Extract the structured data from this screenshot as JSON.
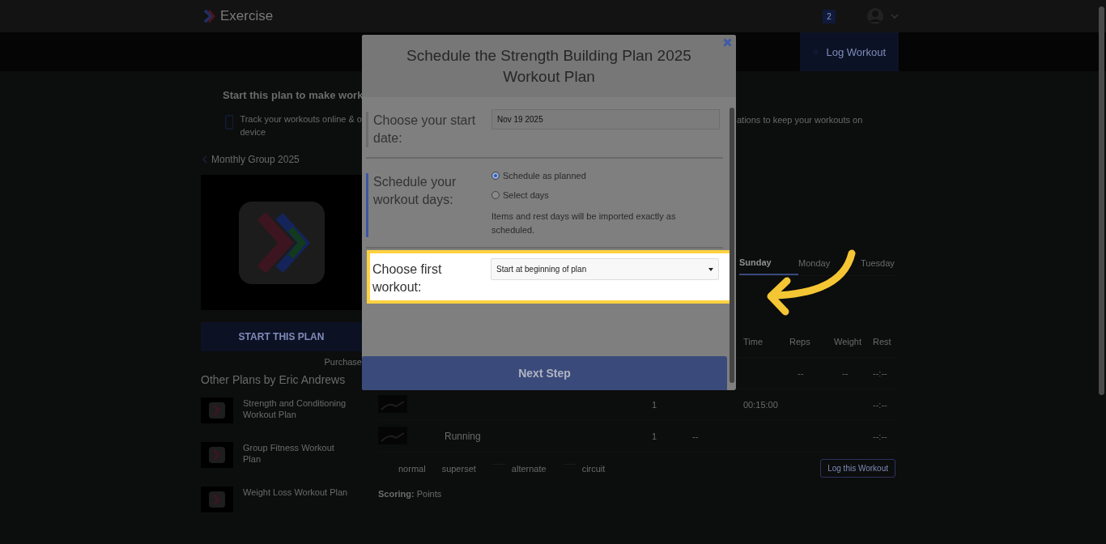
{
  "topbar": {
    "logo": "Exercise",
    "notification_count": "2"
  },
  "action_bar": {
    "log_workout_button": "Log Workout"
  },
  "notice": {
    "title": "Start this plan to make work",
    "text_left": "Track your workouts online & o",
    "text_left_line2": "device",
    "text_right": "ations to keep your workouts on"
  },
  "plan": {
    "back_link": "Monthly Group 2025",
    "start_button": "START THIS PLAN",
    "purchase_note": "Purchase"
  },
  "other_plans": {
    "title": "Other Plans by Eric Andrews",
    "items": [
      {
        "name": "Strength and Conditioning Workout Plan"
      },
      {
        "name": "Group Fitness Workout Plan"
      },
      {
        "name": "Weight Loss Workout Plan"
      }
    ]
  },
  "day_tabs": [
    {
      "label": "Sunday",
      "selected": true
    },
    {
      "label": "Monday",
      "selected": false
    },
    {
      "label": "Tuesday",
      "selected": false
    }
  ],
  "workout_table": {
    "columns": [
      "Time",
      "Reps",
      "Weight",
      "Rest"
    ],
    "rows": [
      {
        "thumbnail": false,
        "name": "",
        "sets": "",
        "time": "",
        "reps": "--",
        "weight": "--",
        "rest": "--:--"
      },
      {
        "thumbnail": true,
        "name": "",
        "sets": "1",
        "time": "00:15:00",
        "reps": "",
        "weight": "",
        "rest": "--:--"
      },
      {
        "thumbnail": true,
        "name": "Running",
        "sets": "1",
        "extra": "--",
        "time": "",
        "reps": "",
        "weight": "",
        "rest": "--:--"
      }
    ]
  },
  "legend": [
    "normal",
    "superset",
    "alternate",
    "circuit"
  ],
  "scoring": {
    "label": "Scoring:",
    "value": "Points"
  },
  "log_this_workout_button": "Log this Workout",
  "modal": {
    "title": "Schedule the Strength Building Plan 2025 Workout Plan",
    "fields": [
      {
        "kind": "date",
        "label": "Choose your start date:",
        "value": "Nov 19 2025",
        "active": false,
        "highlighted": false
      },
      {
        "kind": "radio",
        "label": "Schedule your workout days:",
        "active": true,
        "highlighted": false,
        "options": [
          {
            "label": "Schedule as planned",
            "selected": true
          },
          {
            "label": "Select days",
            "selected": false
          }
        ],
        "note": "Items and rest days will be imported exactly as scheduled."
      },
      {
        "kind": "select",
        "label": "Choose first workout:",
        "value": "Start at beginning of plan",
        "active": false,
        "highlighted": true
      }
    ],
    "next_button": "Next Step"
  }
}
